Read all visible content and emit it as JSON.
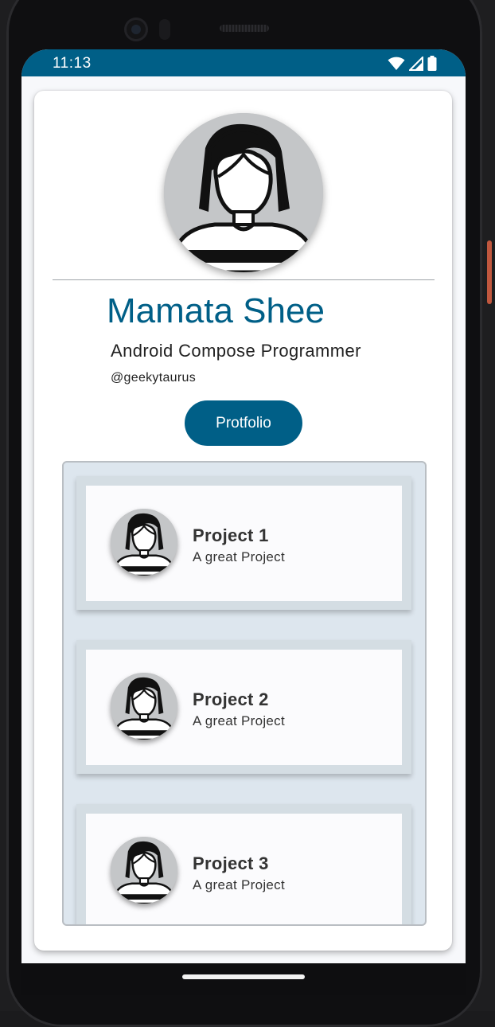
{
  "status_bar": {
    "time": "11:13"
  },
  "profile": {
    "name": "Mamata Shee",
    "role": "Android Compose Programmer",
    "handle": "@geekytaurus",
    "portfolio_label": "Protfolio"
  },
  "projects": [
    {
      "title": "Project 1",
      "description": "A great Project"
    },
    {
      "title": "Project 2",
      "description": "A great Project"
    },
    {
      "title": "Project 3",
      "description": "A great Project"
    }
  ],
  "colors": {
    "primary": "#005f87",
    "list_background": "#dde6ee"
  },
  "icons": {
    "avatar": "person-avatar-icon",
    "wifi": "wifi-icon",
    "signal": "cell-signal-icon",
    "battery": "battery-icon"
  }
}
